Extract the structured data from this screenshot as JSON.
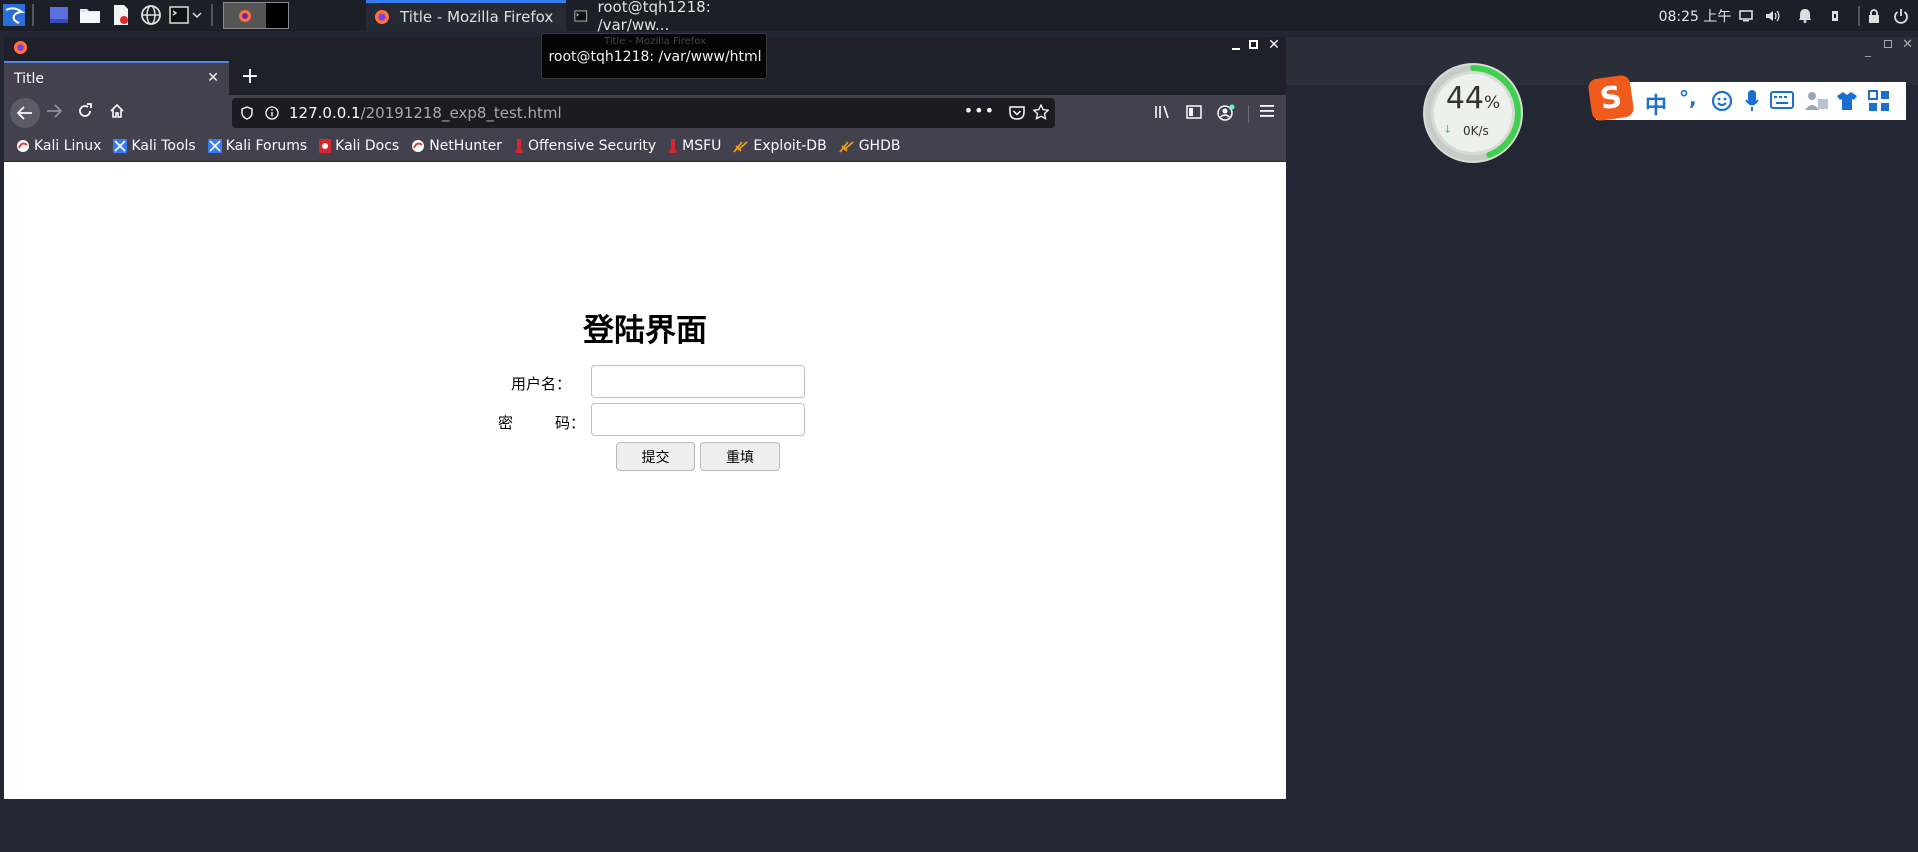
{
  "panel": {
    "tasks": [
      {
        "label": "Title - Mozilla Firefox",
        "active": true
      },
      {
        "label": "root@tqh1218: /var/ww...",
        "active": false
      }
    ],
    "clock": "08:25 上午"
  },
  "window": {
    "title": "Title - Mozilla Firefox",
    "tab_title": "Title",
    "url_host": "127.0.0.1",
    "url_path": "/20191218_exp8_test.html",
    "bookmarks": [
      "Kali Linux",
      "Kali Tools",
      "Kali Forums",
      "Kali Docs",
      "NetHunter",
      "Offensive Security",
      "MSFU",
      "Exploit-DB",
      "GHDB"
    ]
  },
  "tooltip": {
    "title": "Title - Mozilla Firefox",
    "text": "root@tqh1218: /var/www/html"
  },
  "page": {
    "heading": "登陆界面",
    "username_label": "用户名：",
    "password_label_1": "密",
    "password_label_2": "码：",
    "username_value": "",
    "password_value": "",
    "submit_label": "提交",
    "reset_label": "重填"
  },
  "widget": {
    "percent_number": "44",
    "percent_sign": "%",
    "percent_value": 44,
    "speed": "0K/s"
  },
  "ime": {
    "mode": "中",
    "punct": "°,"
  },
  "colors": {
    "accent": "#367bf0",
    "panel_bg": "#1c1f27",
    "desktop_bg": "#222733",
    "gauge_green": "#3ed04e",
    "sogou_orange": "#f05a1a",
    "ime_blue": "#1a6fd1"
  }
}
